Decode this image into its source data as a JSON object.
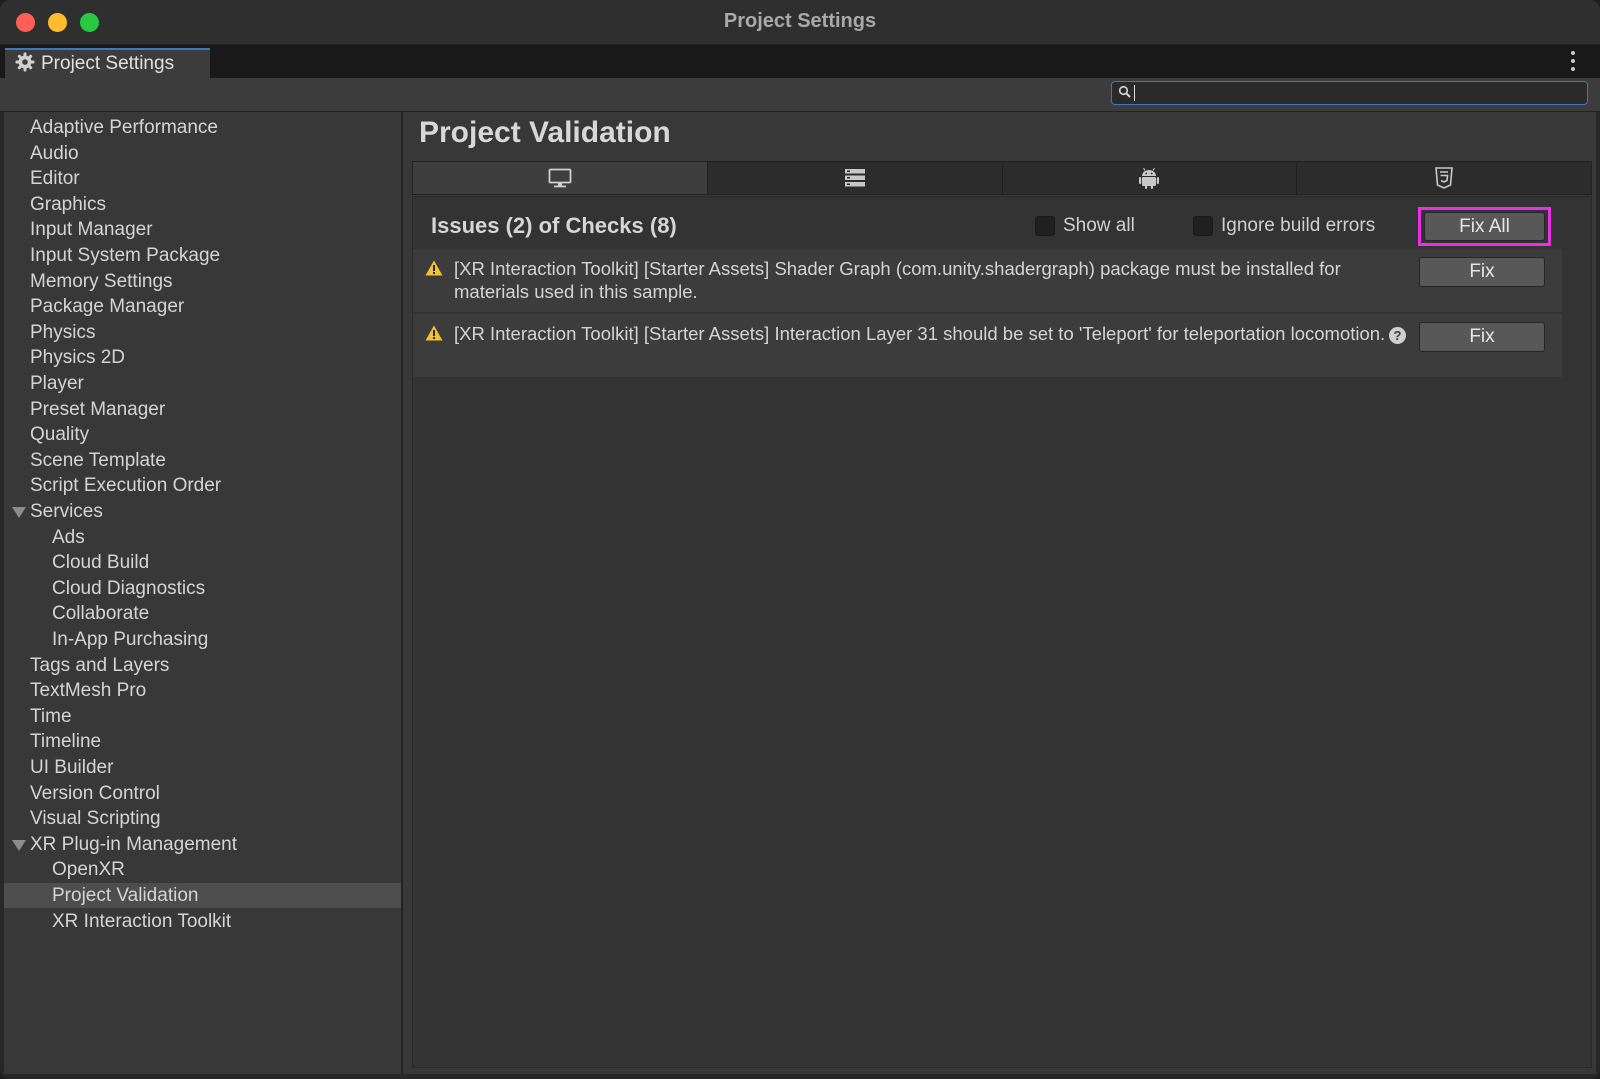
{
  "window": {
    "title": "Project Settings"
  },
  "tab": {
    "label": "Project Settings",
    "icon": "gear-icon"
  },
  "search": {
    "value": "",
    "placeholder": ""
  },
  "sidebar": {
    "items": [
      {
        "label": "Adaptive Performance",
        "level": 0
      },
      {
        "label": "Audio",
        "level": 0
      },
      {
        "label": "Editor",
        "level": 0
      },
      {
        "label": "Graphics",
        "level": 0
      },
      {
        "label": "Input Manager",
        "level": 0
      },
      {
        "label": "Input System Package",
        "level": 0
      },
      {
        "label": "Memory Settings",
        "level": 0
      },
      {
        "label": "Package Manager",
        "level": 0
      },
      {
        "label": "Physics",
        "level": 0
      },
      {
        "label": "Physics 2D",
        "level": 0
      },
      {
        "label": "Player",
        "level": 0
      },
      {
        "label": "Preset Manager",
        "level": 0
      },
      {
        "label": "Quality",
        "level": 0
      },
      {
        "label": "Scene Template",
        "level": 0
      },
      {
        "label": "Script Execution Order",
        "level": 0
      },
      {
        "label": "Services",
        "level": 0,
        "expandable": true
      },
      {
        "label": "Ads",
        "level": 1
      },
      {
        "label": "Cloud Build",
        "level": 1
      },
      {
        "label": "Cloud Diagnostics",
        "level": 1
      },
      {
        "label": "Collaborate",
        "level": 1
      },
      {
        "label": "In-App Purchasing",
        "level": 1
      },
      {
        "label": "Tags and Layers",
        "level": 0
      },
      {
        "label": "TextMesh Pro",
        "level": 0
      },
      {
        "label": "Time",
        "level": 0
      },
      {
        "label": "Timeline",
        "level": 0
      },
      {
        "label": "UI Builder",
        "level": 0
      },
      {
        "label": "Version Control",
        "level": 0
      },
      {
        "label": "Visual Scripting",
        "level": 0
      },
      {
        "label": "XR Plug-in Management",
        "level": 0,
        "expandable": true
      },
      {
        "label": "OpenXR",
        "level": 1
      },
      {
        "label": "Project Validation",
        "level": 1,
        "selected": true
      },
      {
        "label": "XR Interaction Toolkit",
        "level": 1
      }
    ]
  },
  "main": {
    "title": "Project Validation",
    "platform_tabs": [
      {
        "icon": "monitor-icon",
        "active": true
      },
      {
        "icon": "server-icon",
        "active": false
      },
      {
        "icon": "android-icon",
        "active": false
      },
      {
        "icon": "html5-icon",
        "active": false
      }
    ],
    "issues_header": "Issues (2) of Checks (8)",
    "show_all_label": "Show all",
    "ignore_build_errors_label": "Ignore build errors",
    "fix_all_label": "Fix All",
    "issues": [
      {
        "text": "[XR Interaction Toolkit] [Starter Assets] Shader Graph (com.unity.shadergraph) package must be installed for materials used in this sample.",
        "fix_label": "Fix",
        "has_help": false
      },
      {
        "text": "[XR Interaction Toolkit] [Starter Assets] Interaction Layer 31 should be set to 'Teleport' for teleportation locomotion.",
        "fix_label": "Fix",
        "has_help": true
      }
    ]
  },
  "colors": {
    "highlight": "#e831e4",
    "warning": "#f2c230",
    "accent": "#3a79bb"
  }
}
